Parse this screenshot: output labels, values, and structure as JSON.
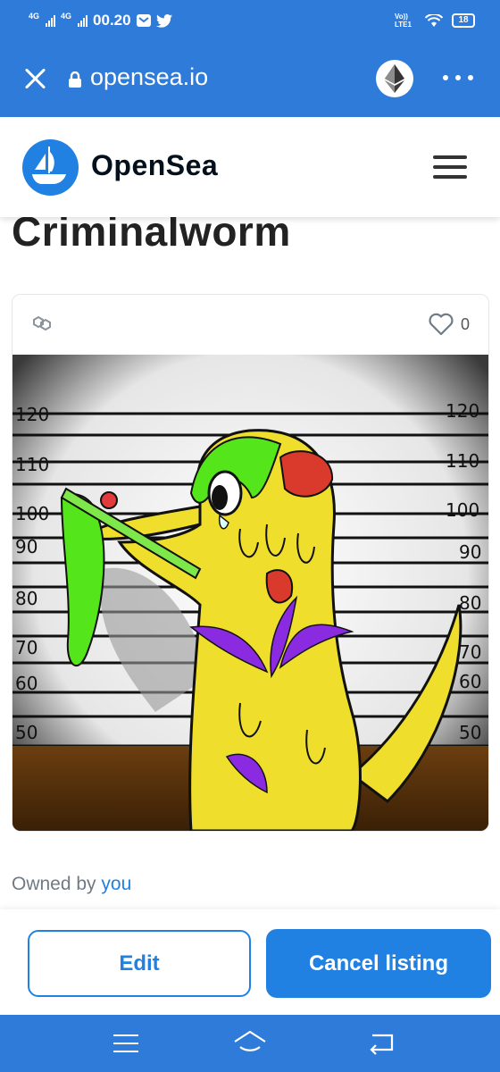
{
  "status_bar": {
    "network_1": "4G",
    "network_2": "4G",
    "time": "00.20",
    "volte": "Vo)) LTE1",
    "battery": "18"
  },
  "browser": {
    "url": "opensea.io",
    "close_icon": "close-icon",
    "lock_icon": "lock-icon",
    "ethereum_icon": "ethereum-icon",
    "more_icon": "more-icon"
  },
  "site_header": {
    "brand": "OpenSea",
    "logo_icon": "opensea-logo-icon",
    "menu_icon": "hamburger-icon"
  },
  "item": {
    "title": "Criminalworm",
    "chain_icon": "polygon-icon",
    "likes": "0",
    "art": {
      "ruler_left": [
        "120",
        "110",
        "100",
        "90",
        "80",
        "70",
        "60",
        "50"
      ],
      "ruler_right": [
        "120",
        "110",
        "100",
        "90",
        "80",
        "70",
        "60",
        "50"
      ]
    }
  },
  "ownership": {
    "prefix": "Owned by",
    "owner": "you"
  },
  "actions": {
    "edit_label": "Edit",
    "cancel_label": "Cancel listing"
  },
  "colors": {
    "browser_bar": "#2f7bd9",
    "brand_blue": "#2081e2",
    "title_text": "#222222"
  }
}
